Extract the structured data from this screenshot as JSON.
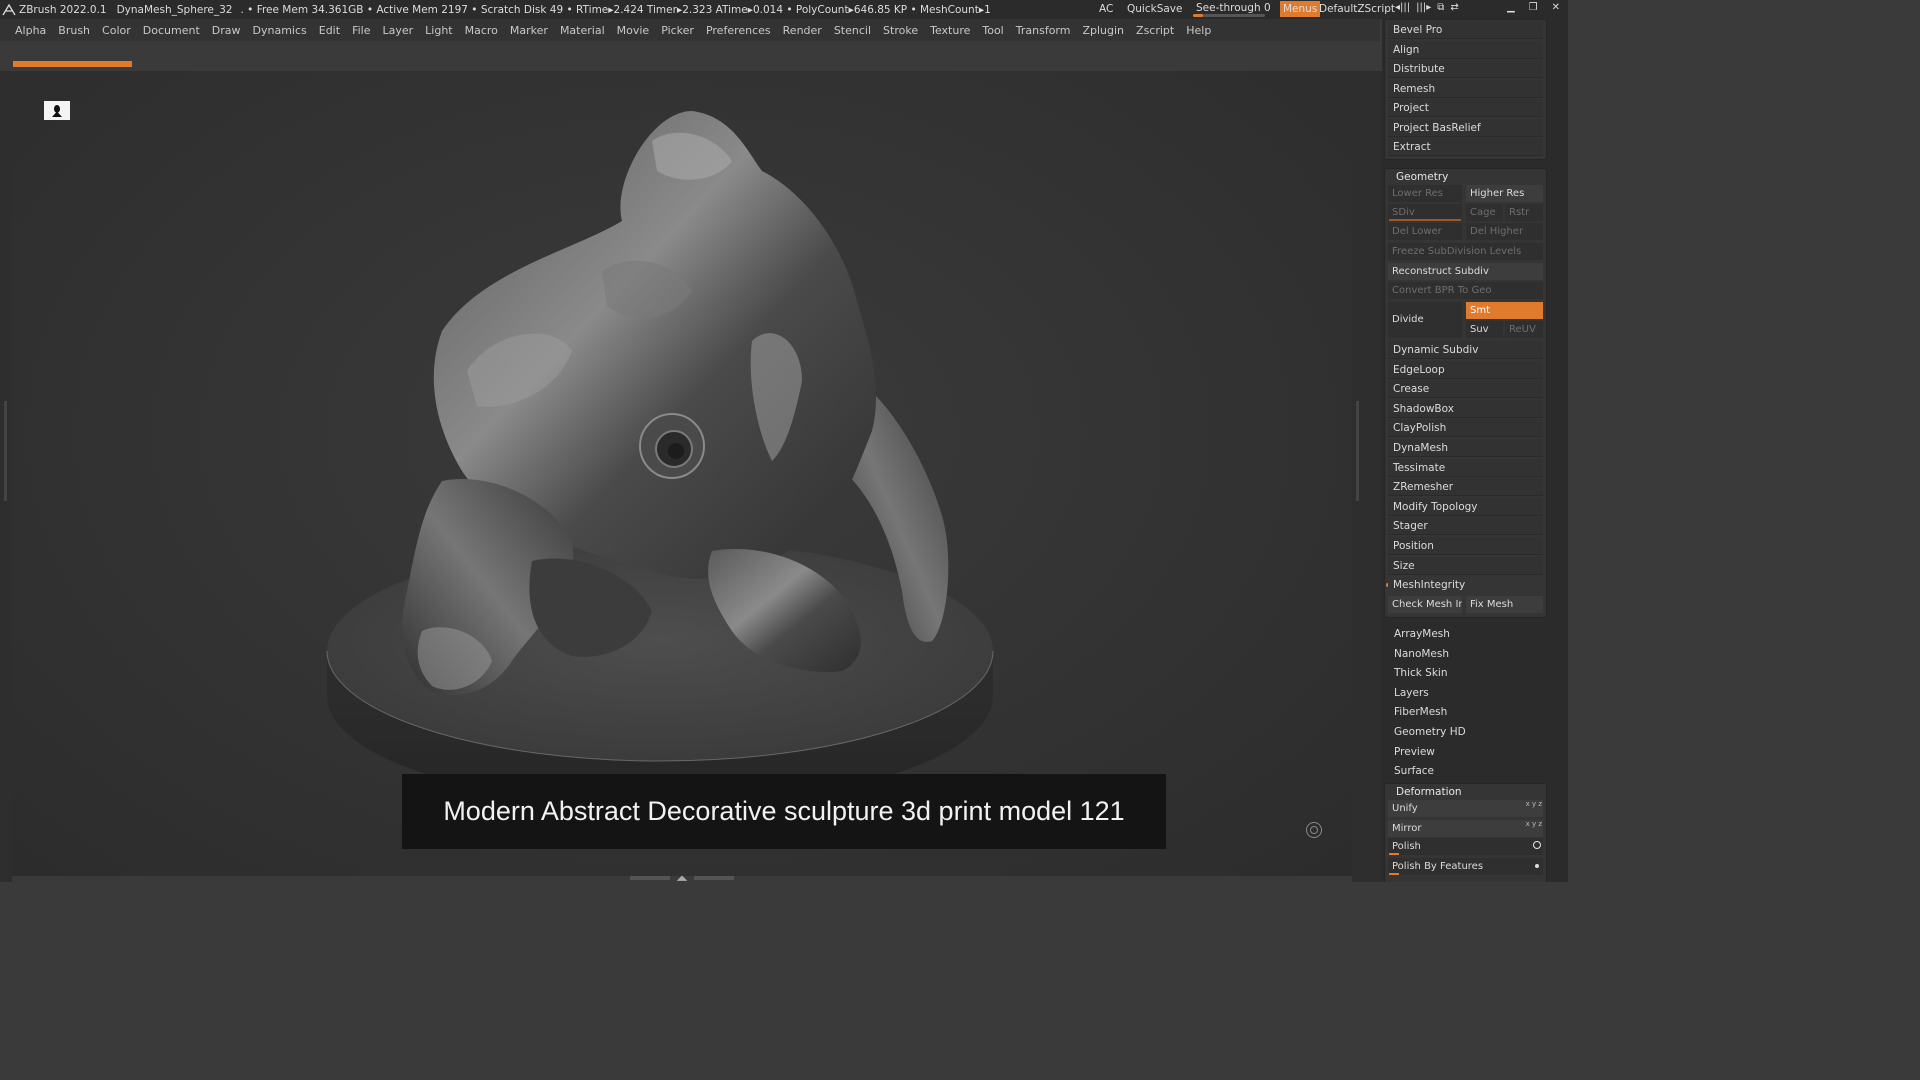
{
  "titlebar": {
    "app": "ZBrush 2022.0.1",
    "tool": "DynaMesh_Sphere_32",
    "stats": ". • Free Mem 34.361GB • Active Mem 2197 • Scratch Disk 49 • RTime▸2.424 Timer▸2.323 ATime▸0.014 • PolyCount▸646.85 KP • MeshCount▸1",
    "ac": "AC",
    "quicksave": "QuickSave",
    "see_through": "See-through  0",
    "see_through_value": 0,
    "menus": "Menus",
    "script": "DefaultZScript",
    "accent": "#e07b2e"
  },
  "menubar": [
    "Alpha",
    "Brush",
    "Color",
    "Document",
    "Draw",
    "Dynamics",
    "Edit",
    "File",
    "Layer",
    "Light",
    "Macro",
    "Marker",
    "Material",
    "Movie",
    "Picker",
    "Preferences",
    "Render",
    "Stencil",
    "Stroke",
    "Texture",
    "Tool",
    "Transform",
    "Zplugin",
    "Zscript",
    "Help"
  ],
  "canvas": {
    "caption": "Modern Abstract Decorative sculpture 3d print model 121",
    "corner_icon": "bust-icon"
  },
  "palette": {
    "top_items": [
      "Bevel Pro",
      "Align",
      "Distribute",
      "Remesh",
      "Project",
      "Project BasRelief",
      "Extract"
    ],
    "geometry": {
      "title": "Geometry",
      "lower_res": "Lower Res",
      "higher_res": "Higher Res",
      "sdiv": "SDiv",
      "cage": "Cage",
      "rstr": "Rstr",
      "del_lower": "Del Lower",
      "del_higher": "Del Higher",
      "freeze": "Freeze SubDivision Levels",
      "reconstruct": "Reconstruct Subdiv",
      "convert": "Convert BPR To Geo",
      "divide": "Divide",
      "smt": "Smt",
      "suv": "Suv",
      "reuv": "ReUV",
      "subsections": [
        "Dynamic Subdiv",
        "EdgeLoop",
        "Crease",
        "ShadowBox",
        "ClayPolish",
        "DynaMesh",
        "Tessimate",
        "ZRemesher",
        "Modify Topology",
        "Stager",
        "Position",
        "Size"
      ],
      "meshintegrity": "MeshIntegrity",
      "check_mesh": "Check Mesh Int",
      "fix_mesh": "Fix Mesh"
    },
    "tool_subpalettes": [
      "ArrayMesh",
      "NanoMesh",
      "Thick Skin",
      "Layers",
      "FiberMesh",
      "Geometry HD",
      "Preview",
      "Surface"
    ],
    "deformation": {
      "title": "Deformation",
      "unify": "Unify",
      "mirror": "Mirror",
      "polish": "Polish",
      "polish_features": "Polish By Features"
    }
  }
}
